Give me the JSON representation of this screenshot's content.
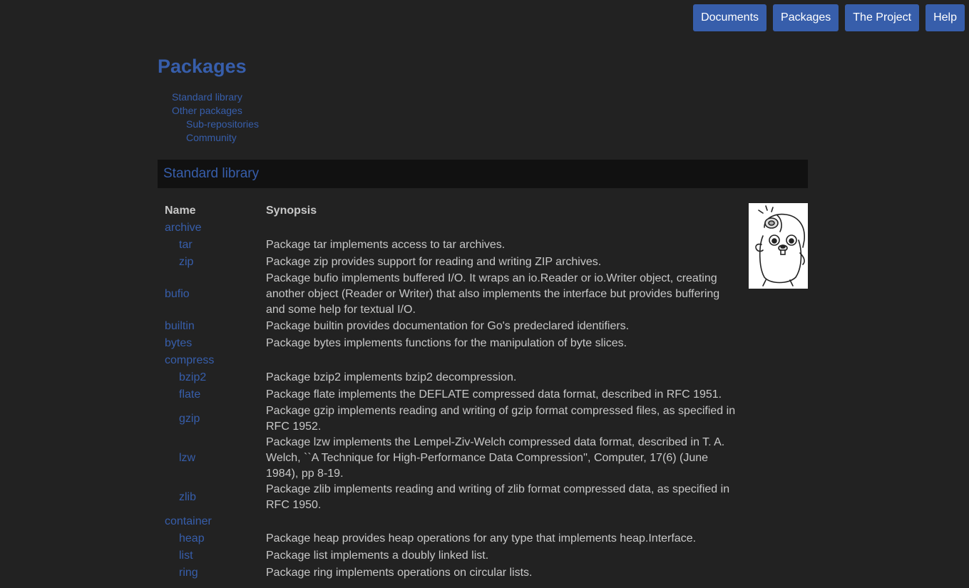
{
  "nav": [
    {
      "label": "Documents",
      "name": "nav-documents"
    },
    {
      "label": "Packages",
      "name": "nav-packages"
    },
    {
      "label": "The Project",
      "name": "nav-the-project"
    },
    {
      "label": "Help",
      "name": "nav-help"
    }
  ],
  "page_title": "Packages",
  "toc": [
    {
      "label": "Standard library",
      "level": 0
    },
    {
      "label": "Other packages",
      "level": 0
    },
    {
      "label": "Sub-repositories",
      "level": 1
    },
    {
      "label": "Community",
      "level": 1
    }
  ],
  "section_title": "Standard library",
  "table": {
    "headers": {
      "name": "Name",
      "synopsis": "Synopsis"
    },
    "rows": [
      {
        "name": "archive",
        "indent": false,
        "synopsis": ""
      },
      {
        "name": "tar",
        "indent": true,
        "synopsis": "Package tar implements access to tar archives."
      },
      {
        "name": "zip",
        "indent": true,
        "synopsis": "Package zip provides support for reading and writing ZIP archives."
      },
      {
        "name": "bufio",
        "indent": false,
        "synopsis": "Package bufio implements buffered I/O. It wraps an io.Reader or io.Writer object, creating another object (Reader or Writer) that also implements the interface but provides buffering and some help for textual I/O."
      },
      {
        "name": "builtin",
        "indent": false,
        "synopsis": "Package builtin provides documentation for Go's predeclared identifiers."
      },
      {
        "name": "bytes",
        "indent": false,
        "synopsis": "Package bytes implements functions for the manipulation of byte slices."
      },
      {
        "name": "compress",
        "indent": false,
        "synopsis": ""
      },
      {
        "name": "bzip2",
        "indent": true,
        "synopsis": "Package bzip2 implements bzip2 decompression."
      },
      {
        "name": "flate",
        "indent": true,
        "synopsis": "Package flate implements the DEFLATE compressed data format, described in RFC 1951."
      },
      {
        "name": "gzip",
        "indent": true,
        "synopsis": "Package gzip implements reading and writing of gzip format compressed files, as specified in RFC 1952."
      },
      {
        "name": "lzw",
        "indent": true,
        "synopsis": "Package lzw implements the Lempel-Ziv-Welch compressed data format, described in T. A. Welch, ``A Technique for High-Performance Data Compression'', Computer, 17(6) (June 1984), pp 8-19."
      },
      {
        "name": "zlib",
        "indent": true,
        "synopsis": "Package zlib implements reading and writing of zlib format compressed data, as specified in RFC 1950."
      },
      {
        "name": "container",
        "indent": false,
        "synopsis": ""
      },
      {
        "name": "heap",
        "indent": true,
        "synopsis": "Package heap provides heap operations for any type that implements heap.Interface."
      },
      {
        "name": "list",
        "indent": true,
        "synopsis": "Package list implements a doubly linked list."
      },
      {
        "name": "ring",
        "indent": true,
        "synopsis": "Package ring implements operations on circular lists."
      }
    ]
  }
}
